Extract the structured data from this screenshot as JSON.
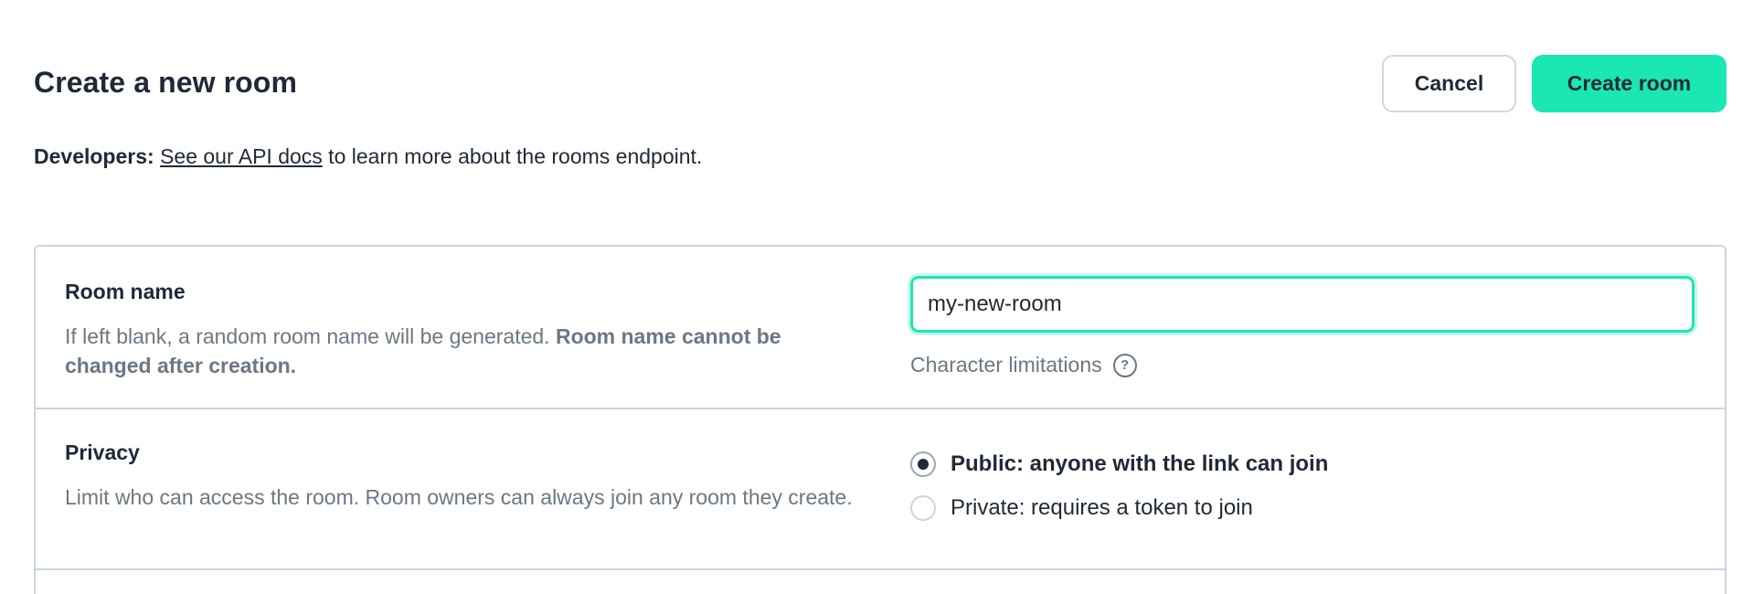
{
  "header": {
    "title": "Create a new room",
    "cancel_label": "Cancel",
    "create_label": "Create room"
  },
  "developers": {
    "label": "Developers:",
    "link_text": "See our API docs",
    "suffix": " to learn more about the rooms endpoint."
  },
  "room_name": {
    "title": "Room name",
    "desc_plain": "If left blank, a random room name will be generated. ",
    "desc_bold": "Room name cannot be changed after creation.",
    "input_value": "my-new-room",
    "char_limitations": "Character limitations",
    "help_icon": "question-circle-icon"
  },
  "privacy": {
    "title": "Privacy",
    "desc": "Limit who can access the room. Room owners can always join any room they create.",
    "options": [
      {
        "label": "Public: anyone with the link can join",
        "selected": true
      },
      {
        "label": "Private: requires a token to join",
        "selected": false
      }
    ]
  },
  "colors": {
    "accent": "#1be7b4",
    "text": "#1f2937",
    "muted": "#6b7785",
    "border": "#cbd5e1"
  }
}
